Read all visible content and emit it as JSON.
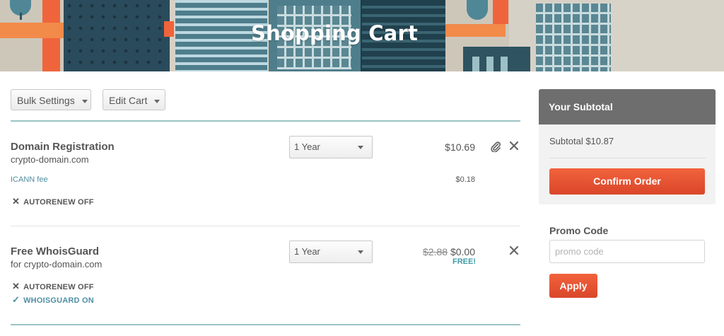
{
  "banner": {
    "title": "Shopping Cart"
  },
  "toolbar": {
    "bulk_settings": "Bulk Settings",
    "edit_cart": "Edit Cart"
  },
  "items": [
    {
      "title": "Domain Registration",
      "domain": "crypto-domain.com",
      "period": "1 Year",
      "price": "$10.69",
      "fee_label": "ICANN fee",
      "fee_price": "$0.18",
      "autorenew": "AUTORENEW OFF"
    },
    {
      "title": "Free WhoisGuard",
      "domain": "for crypto-domain.com",
      "period": "1 Year",
      "old_price": "$2.88",
      "price": "$0.00",
      "badge": "FREE!",
      "autorenew": "AUTORENEW OFF",
      "whoisguard": "WHOISGUARD ON"
    }
  ],
  "summary": {
    "header": "Your Subtotal",
    "subtotal": "Subtotal $10.87",
    "confirm": "Confirm Order"
  },
  "promo": {
    "label": "Promo Code",
    "placeholder": "promo code",
    "apply": "Apply"
  },
  "colors": {
    "accent": "#e8543a",
    "divider": "#9bc4c4",
    "link": "#4f8fa3",
    "summary_header": "#6e6e6e"
  },
  "icons": [
    "chevron-down-icon",
    "paperclip-icon",
    "close-icon",
    "checkmark-icon"
  ]
}
